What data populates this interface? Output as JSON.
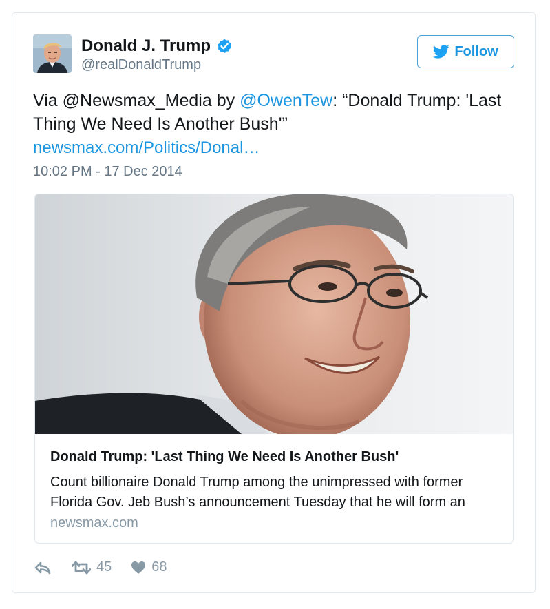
{
  "user": {
    "display_name": "Donald J. Trump",
    "handle": "@realDonaldTrump",
    "verified_icon": "verified-badge-icon",
    "avatar_icon": "avatar-photo"
  },
  "follow_button": {
    "label": "Follow",
    "icon": "twitter-bird-icon"
  },
  "tweet": {
    "text_prefix": "Via ",
    "mention1": "@Newsmax_Media",
    "text_mid": " by ",
    "mention2": "@OwenTew",
    "text_suffix": ": “Donald Trump: 'Last Thing We Need Is Another Bush'”",
    "link": "newsmax.com/Politics/Donal…",
    "timestamp": "10:02 PM - 17 Dec 2014"
  },
  "card": {
    "title": "Donald Trump: 'Last Thing We Need Is Another Bush'",
    "description": "Count billionaire Donald Trump among the unimpressed with former Florida Gov. Jeb Bush’s announcement Tuesday that he will form an",
    "domain": "newsmax.com"
  },
  "actions": {
    "reply_icon": "reply-icon",
    "retweet_icon": "retweet-icon",
    "retweet_count": "45",
    "like_icon": "heart-icon",
    "like_count": "68"
  },
  "colors": {
    "link": "#1b95e0",
    "muted": "#657786",
    "border": "#e1e8ed",
    "action": "#8899a6"
  }
}
